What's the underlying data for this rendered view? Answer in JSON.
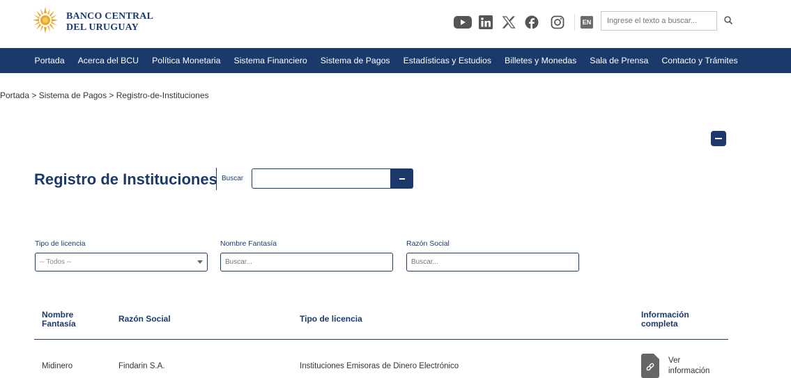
{
  "header": {
    "brand_line1": "BANCO CENTRAL",
    "brand_line2": "DEL URUGUAY",
    "language_button": "EN",
    "search_placeholder": "Ingrese el texto a buscar...",
    "social_icons": [
      "youtube-icon",
      "linkedin-icon",
      "x-icon",
      "facebook-icon",
      "instagram-icon"
    ]
  },
  "nav": {
    "items": [
      {
        "label": "Portada"
      },
      {
        "label": "Acerca del BCU"
      },
      {
        "label": "Política Monetaria"
      },
      {
        "label": "Sistema Financiero"
      },
      {
        "label": "Sistema de Pagos"
      },
      {
        "label": "Estadísticas y Estudios"
      },
      {
        "label": "Billetes y Monedas"
      },
      {
        "label": "Sala de Prensa"
      },
      {
        "label": "Contacto y Trámites"
      }
    ]
  },
  "breadcrumb": "Portada > Sistema de Pagos > Registro-de-Instituciones",
  "main": {
    "title": "Registro de Instituciones",
    "search_label": "Buscar",
    "search_value": ""
  },
  "filters": {
    "tipo_label": "Tipo de licencia",
    "tipo_value": "-- Todos --",
    "fantasia_label": "Nombre Fantasía",
    "fantasia_placeholder": "Buscar...",
    "razon_label": "Razón Social",
    "razon_placeholder": "Buscar..."
  },
  "table": {
    "headers": {
      "nombre_l1": "Nombre",
      "nombre_l2": "Fantasía",
      "razon": "Razón Social",
      "tipo": "Tipo de licencia",
      "info_l1": "Información",
      "info_l2": "completa"
    },
    "rows": [
      {
        "nombre": "Midinero",
        "razon": "Findarin S.A.",
        "tipo": "Instituciones Emisoras de Dinero Electrónico",
        "info_l1": "Ver",
        "info_l2": "información"
      }
    ]
  },
  "colors": {
    "brand_navy": "#1b3a6b",
    "logo_gold": "#e8a825"
  }
}
